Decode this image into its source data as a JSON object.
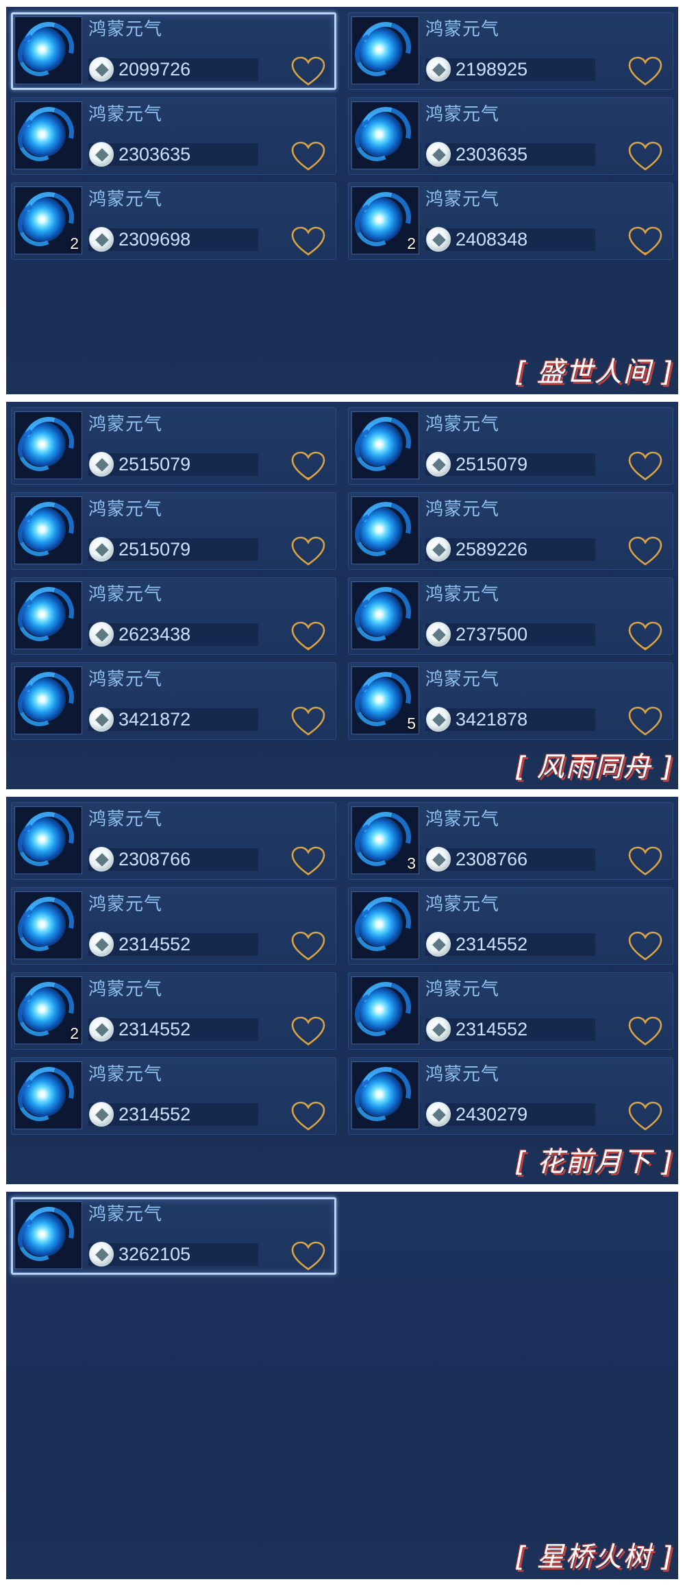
{
  "sections": [
    {
      "label": "[ 盛世人间 ]",
      "items": [
        {
          "name": "鸿蒙元气",
          "price": "2099726",
          "count": "",
          "selected": true,
          "heart_fill": 0
        },
        {
          "name": "鸿蒙元气",
          "price": "2198925",
          "count": "",
          "selected": false,
          "heart_fill": 0
        },
        {
          "name": "鸿蒙元气",
          "price": "2303635",
          "count": "",
          "selected": false,
          "heart_fill": 0
        },
        {
          "name": "鸿蒙元气",
          "price": "2303635",
          "count": "",
          "selected": false,
          "heart_fill": 0
        },
        {
          "name": "鸿蒙元气",
          "price": "2309698",
          "count": "2",
          "selected": false,
          "heart_fill": 0
        },
        {
          "name": "鸿蒙元气",
          "price": "2408348",
          "count": "2",
          "selected": false,
          "heart_fill": 0.15
        }
      ]
    },
    {
      "label": "[ 风雨同舟 ]",
      "items": [
        {
          "name": "鸿蒙元气",
          "price": "2515079",
          "count": "",
          "selected": false,
          "heart_fill": 0.15
        },
        {
          "name": "鸿蒙元气",
          "price": "2515079",
          "count": "",
          "selected": false,
          "heart_fill": 0
        },
        {
          "name": "鸿蒙元气",
          "price": "2515079",
          "count": "",
          "selected": false,
          "heart_fill": 0
        },
        {
          "name": "鸿蒙元气",
          "price": "2589226",
          "count": "",
          "selected": false,
          "heart_fill": 0
        },
        {
          "name": "鸿蒙元气",
          "price": "2623438",
          "count": "",
          "selected": false,
          "heart_fill": 0.15
        },
        {
          "name": "鸿蒙元气",
          "price": "2737500",
          "count": "",
          "selected": false,
          "heart_fill": 0.15
        },
        {
          "name": "鸿蒙元气",
          "price": "3421872",
          "count": "",
          "selected": false,
          "heart_fill": 0
        },
        {
          "name": "鸿蒙元气",
          "price": "3421878",
          "count": "5",
          "selected": false,
          "heart_fill": 0
        }
      ]
    },
    {
      "label": "[ 花前月下 ]",
      "items": [
        {
          "name": "鸿蒙元气",
          "price": "2308766",
          "count": "",
          "selected": false,
          "heart_fill": 0
        },
        {
          "name": "鸿蒙元气",
          "price": "2308766",
          "count": "3",
          "selected": false,
          "heart_fill": 0
        },
        {
          "name": "鸿蒙元气",
          "price": "2314552",
          "count": "",
          "selected": false,
          "heart_fill": 0
        },
        {
          "name": "鸿蒙元气",
          "price": "2314552",
          "count": "",
          "selected": false,
          "heart_fill": 0
        },
        {
          "name": "鸿蒙元气",
          "price": "2314552",
          "count": "2",
          "selected": false,
          "heart_fill": 0
        },
        {
          "name": "鸿蒙元气",
          "price": "2314552",
          "count": "",
          "selected": false,
          "heart_fill": 0
        },
        {
          "name": "鸿蒙元气",
          "price": "2314552",
          "count": "",
          "selected": false,
          "heart_fill": 0
        },
        {
          "name": "鸿蒙元气",
          "price": "2430279",
          "count": "",
          "selected": false,
          "heart_fill": 0
        }
      ]
    },
    {
      "label": "[ 星桥火树 ]",
      "items": [
        {
          "name": "鸿蒙元气",
          "price": "3262105",
          "count": "",
          "selected": true,
          "heart_fill": 0
        }
      ]
    }
  ],
  "colors": {
    "panel_bg": "#1d3461",
    "item_name": "#8fc0f0",
    "price_text": "#c9e3ff",
    "heart_outline": "#d9a441",
    "heart_fill": "#f07a12",
    "label_shadow": "#c0403d"
  },
  "icons": {
    "item": "blue-vortex-icon",
    "currency": "coin-icon",
    "favorite": "heart-icon"
  }
}
